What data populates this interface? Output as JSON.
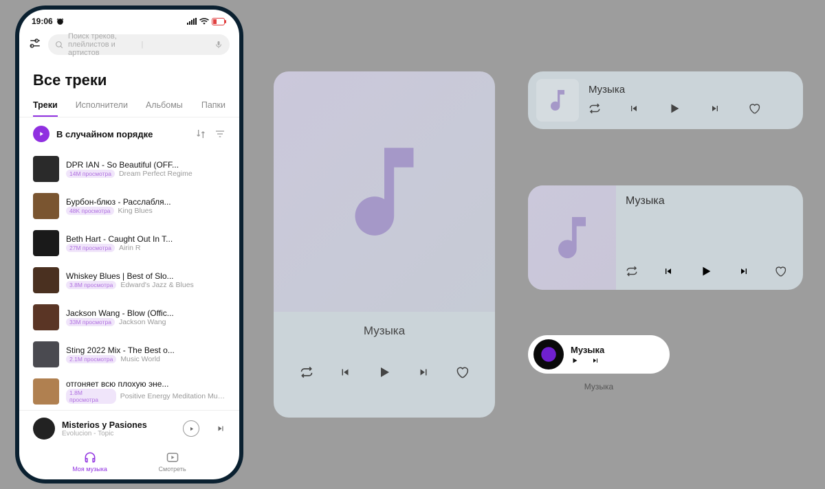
{
  "statusbar": {
    "time": "19:06"
  },
  "search": {
    "placeholder": "Поиск треков, плейлистов и артистов"
  },
  "header": {
    "title": "Все треки"
  },
  "tabs": [
    "Треки",
    "Исполнители",
    "Альбомы",
    "Папки"
  ],
  "shuffle": {
    "label": "В случайном порядке"
  },
  "tracks": [
    {
      "title": "DPR IAN - So Beautiful (OFF...",
      "views": "14M просмотра",
      "artist": "Dream Perfect Regime"
    },
    {
      "title": "Бурбон-блюз - Расслабля...",
      "views": "48K просмотра",
      "artist": "King Blues"
    },
    {
      "title": "Beth Hart - Caught Out In T...",
      "views": "27M просмотра",
      "artist": "Airin R"
    },
    {
      "title": "Whiskey Blues | Best of Slo...",
      "views": "3.8M просмотра",
      "artist": "Edward's Jazz & Blues"
    },
    {
      "title": "Jackson Wang - Blow (Offic...",
      "views": "33M просмотра",
      "artist": "Jackson Wang"
    },
    {
      "title": "Sting 2022 Mix - The Best o...",
      "views": "2.1M просмотра",
      "artist": "Music World"
    },
    {
      "title": "отгоняет всю плохую эне...",
      "views": "1.8M просмотра",
      "artist": "Positive Energy Meditation Music"
    }
  ],
  "nowplaying": {
    "title": "Misterios y Pasiones",
    "artist": "Evolucion - Topic"
  },
  "bottomnav": {
    "music": "Моя музыка",
    "watch": "Смотреть"
  },
  "widgets": {
    "large": {
      "title": "Музыка"
    },
    "med1": {
      "title": "Музыка"
    },
    "med2": {
      "title": "Музыка"
    },
    "pill": {
      "title": "Музыка",
      "caption": "Музыка"
    }
  }
}
